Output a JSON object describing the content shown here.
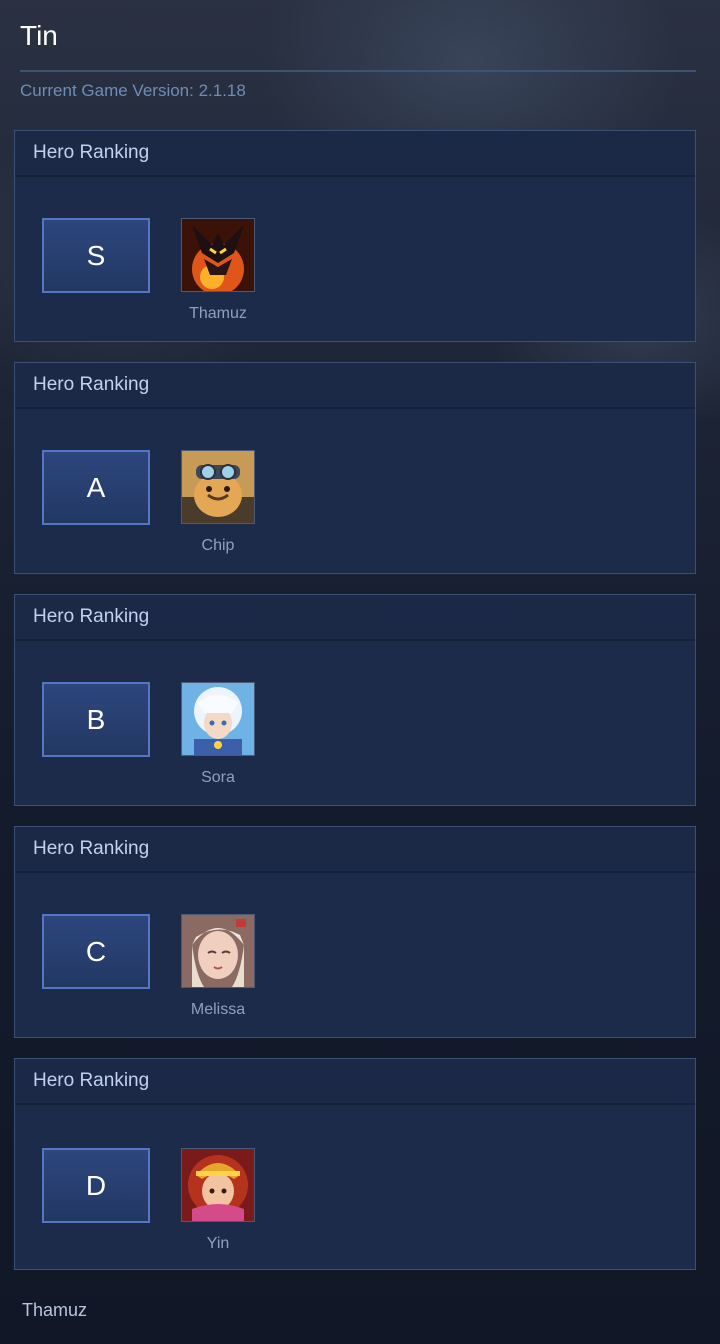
{
  "page": {
    "title": "Tin",
    "version_text": "Current Game Version: 2.1.18",
    "footer_text": "Thamuz"
  },
  "rankings": [
    {
      "header": "Hero Ranking",
      "tier": "S",
      "hero": "Thamuz"
    },
    {
      "header": "Hero Ranking",
      "tier": "A",
      "hero": "Chip"
    },
    {
      "header": "Hero Ranking",
      "tier": "B",
      "hero": "Sora"
    },
    {
      "header": "Hero Ranking",
      "tier": "C",
      "hero": "Melissa"
    },
    {
      "header": "Hero Ranking",
      "tier": "D",
      "hero": "Yin"
    }
  ],
  "colors": {
    "background": "#121829",
    "card": "#1d2b4a",
    "tier_border": "#5576c4",
    "version_text": "#6f8cb8"
  }
}
